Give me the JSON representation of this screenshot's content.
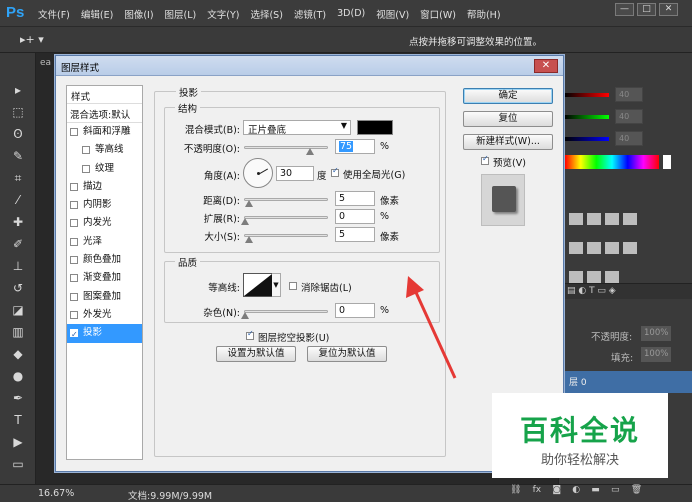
{
  "app": {
    "logo": "Ps"
  },
  "menu": [
    "文件(F)",
    "编辑(E)",
    "图像(I)",
    "图层(L)",
    "文字(Y)",
    "选择(S)",
    "滤镜(T)",
    "3D(D)",
    "视图(V)",
    "窗口(W)",
    "帮助(H)"
  ],
  "window_controls": [
    "—",
    "□",
    "✕"
  ],
  "options_bar": {
    "tool_glyph": "▸+ ▾",
    "hint": "点按并拖移可调整效果的位置。"
  },
  "doc_tab": "ea",
  "status": {
    "zoom": "16.67%",
    "doc_info": "文档:9.99M/9.99M"
  },
  "right_panel": {
    "color_values": [
      "40",
      "40",
      "40"
    ],
    "opacity_label": "不透明度:",
    "opacity_value": "100%",
    "fill_label": "填充:",
    "fill_value": "100%",
    "layer_name": "层 0"
  },
  "dialog": {
    "title": "图层样式",
    "close": "✕",
    "style_list": {
      "header": "样式",
      "blend_options": "混合选项:默认",
      "items": [
        {
          "label": "斜面和浮雕",
          "checked": false,
          "sub": false
        },
        {
          "label": "等高线",
          "checked": false,
          "sub": true
        },
        {
          "label": "纹理",
          "checked": false,
          "sub": true
        },
        {
          "label": "描边",
          "checked": false,
          "sub": false
        },
        {
          "label": "内阴影",
          "checked": false,
          "sub": false
        },
        {
          "label": "内发光",
          "checked": false,
          "sub": false
        },
        {
          "label": "光泽",
          "checked": false,
          "sub": false
        },
        {
          "label": "颜色叠加",
          "checked": false,
          "sub": false
        },
        {
          "label": "渐变叠加",
          "checked": false,
          "sub": false
        },
        {
          "label": "图案叠加",
          "checked": false,
          "sub": false
        },
        {
          "label": "外发光",
          "checked": false,
          "sub": false
        },
        {
          "label": "投影",
          "checked": true,
          "sub": false,
          "active": true
        }
      ]
    },
    "section_title": "投影",
    "structure": {
      "title": "结构",
      "blend_mode_label": "混合模式(B):",
      "blend_mode_value": "正片叠底",
      "blend_color": "#000000",
      "opacity_label": "不透明度(O):",
      "opacity_value": "75",
      "opacity_unit": "%",
      "angle_label": "角度(A):",
      "angle_value": "30",
      "angle_unit": "度",
      "global_light_label": "使用全局光(G)",
      "global_light_checked": true,
      "distance_label": "距离(D):",
      "distance_value": "5",
      "distance_unit": "像素",
      "spread_label": "扩展(R):",
      "spread_value": "0",
      "spread_unit": "%",
      "size_label": "大小(S):",
      "size_value": "5",
      "size_unit": "像素"
    },
    "quality": {
      "title": "品质",
      "contour_label": "等高线:",
      "antialias_label": "消除锯齿(L)",
      "antialias_checked": false,
      "noise_label": "杂色(N):",
      "noise_value": "0",
      "noise_unit": "%"
    },
    "knockout_label": "图层挖空投影(U)",
    "knockout_checked": true,
    "set_default": "设置为默认值",
    "reset_default": "复位为默认值",
    "buttons": {
      "ok": "确定",
      "reset": "复位",
      "new_style": "新建样式(W)..."
    },
    "preview_label": "预览(V)",
    "preview_checked": true
  },
  "watermark": {
    "title": "百科全说",
    "subtitle": "助你轻松解决"
  },
  "colors": {
    "accent": "#3399ff",
    "watermark_green": "#16a34a",
    "arrow": "#e53935"
  }
}
